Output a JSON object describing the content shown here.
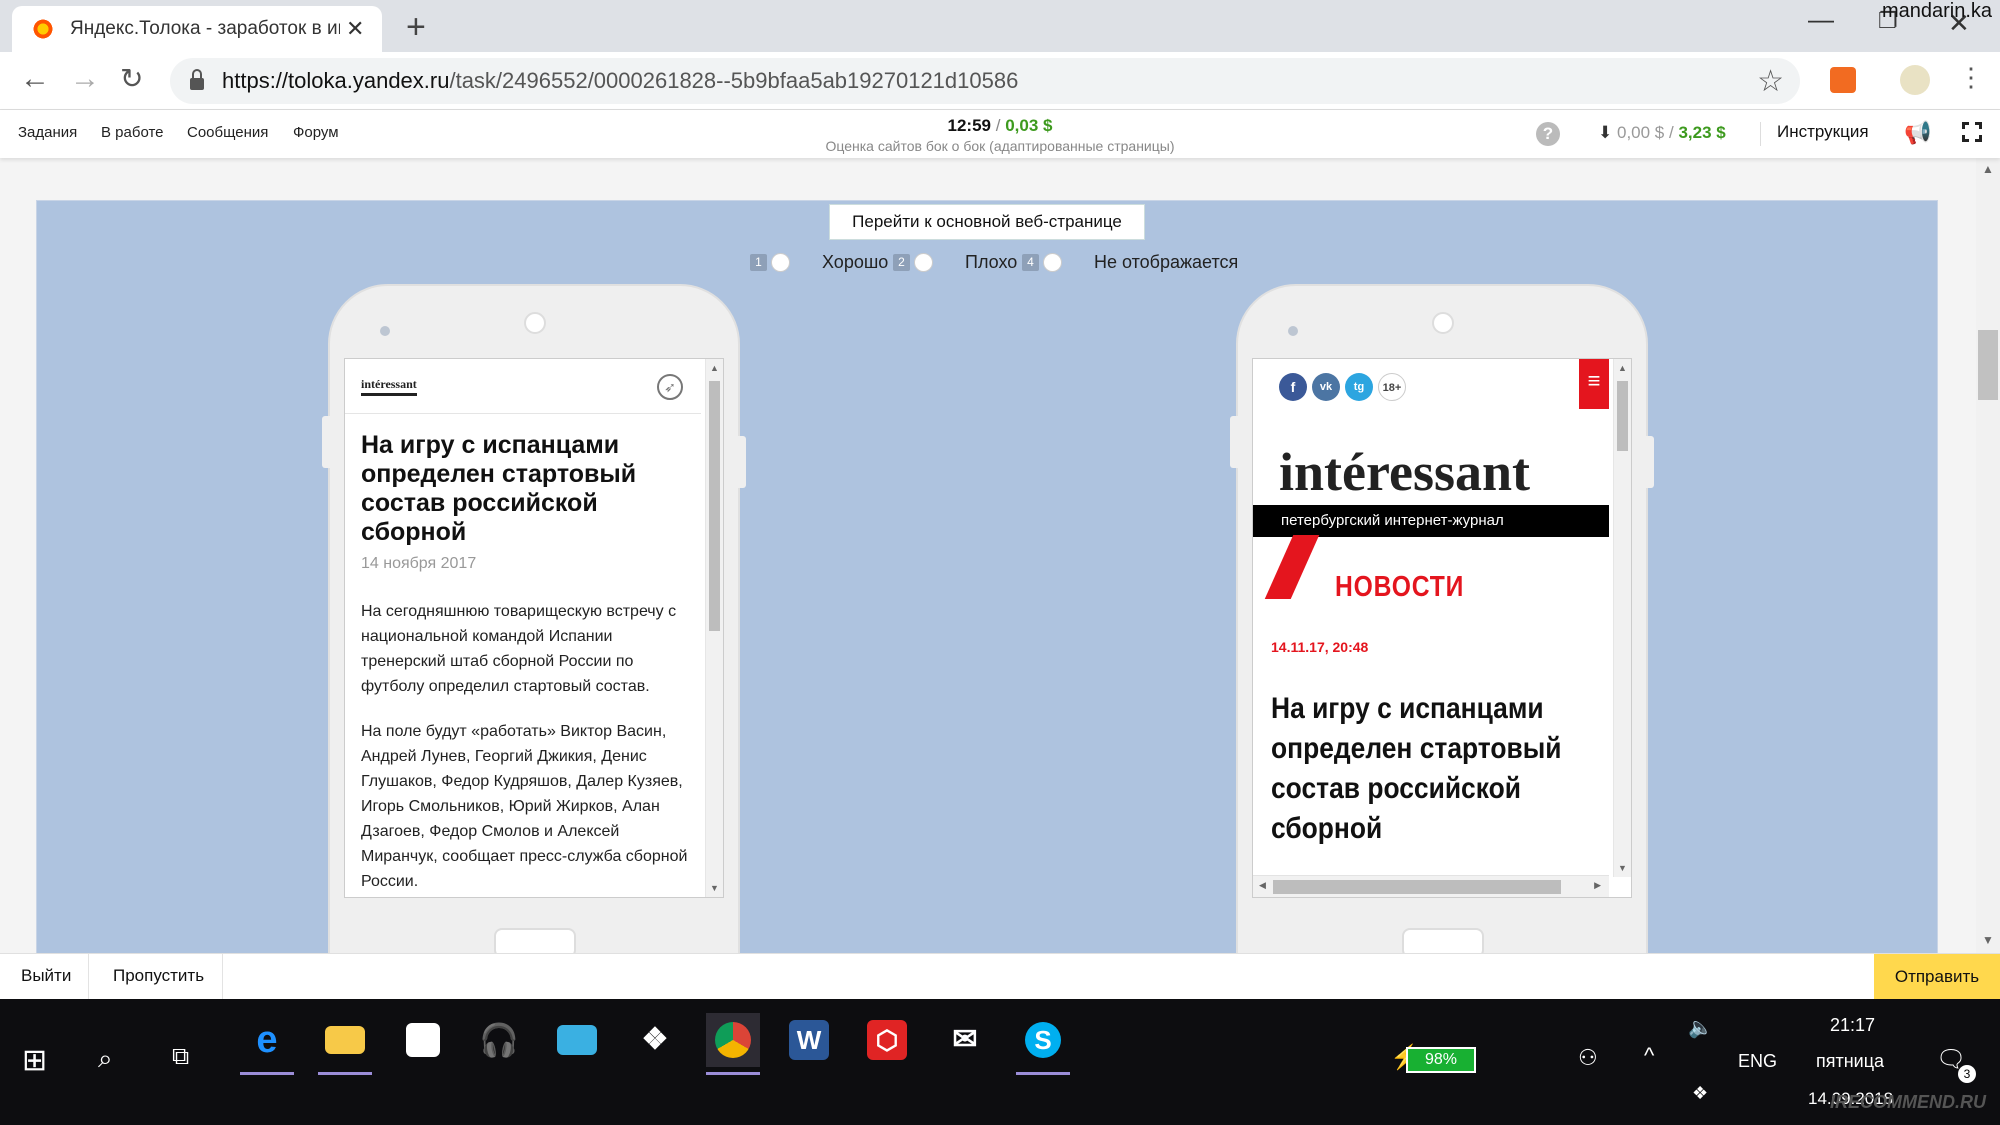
{
  "browser": {
    "tab_title": "Яндекс.Толока - заработок в ин",
    "tab_close": "✕",
    "new_tab": "+",
    "url_host": "https://toloka.yandex.ru",
    "url_path": "/task/2496552/0000261828--5b9bfaa5ab19270121d10586",
    "user_name": "mandarin.ka"
  },
  "toloka_header": {
    "nav": [
      "Задания",
      "В работе",
      "Сообщения",
      "Форум"
    ],
    "timer": "12:59",
    "timer_sep": "/",
    "task_reward": "0,03 $",
    "task_title": "Оценка сайтов бок о бок (адаптированные страницы)",
    "help": "?",
    "balance_pending": "0,00 $",
    "balance_sep": "/",
    "balance_available": "3,23 $",
    "instructions": "Инструкция"
  },
  "task": {
    "goto_button": "Перейти к основной веб-странице",
    "options": [
      {
        "key": "1",
        "label": "Хорошо"
      },
      {
        "key": "2",
        "label": "Плохо"
      },
      {
        "key": "4",
        "label": "Не отображается"
      }
    ]
  },
  "left_site": {
    "logo": "intéressant",
    "headline": "На игру с испанцами определен стартовый состав российской сборной",
    "date": "14 ноября 2017",
    "para1": "На сегодняшнюю товарищескую встречу с национальной командой Испании тренерский штаб сборной России по футболу определил стартовый состав.",
    "para2": "На поле будут «работать» Виктор Васин, Андрей Лунев, Георгий Джикия, Денис Глушаков, Федор Кудряшов, Далер Кузяев, Игорь Смольников, Юрий Жирков, Алан Дзагоев, Федор Смолов и Алексей Миранчук, сообщает пресс-служба сборной России."
  },
  "right_site": {
    "social": [
      "f",
      "vk",
      "tg"
    ],
    "age_rating": "18+",
    "logo": "intéressant",
    "tagline": "петербургский интернет-журнал",
    "section": "НОВОСТИ",
    "date": "14.11.17, 20:48",
    "headline": "На игру с испанцами определен стартовый состав российской сборной"
  },
  "footer": {
    "exit": "Выйти",
    "skip": "Пропустить",
    "submit": "Отправить"
  },
  "taskbar": {
    "battery": "98%",
    "lang": "ENG",
    "time": "21:17",
    "day": "пятница",
    "date": "14.09.2018",
    "notifications": "3",
    "watermark": "IRECOMMEND.RU"
  },
  "colors": {
    "money_green": "#3d9a1e",
    "task_bg": "#aec3df",
    "submit_yellow": "#ffd84d",
    "brand_red": "#e4151e"
  }
}
